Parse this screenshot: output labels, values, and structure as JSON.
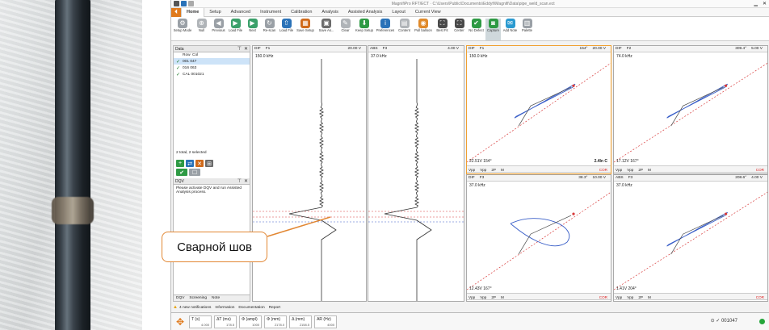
{
  "window": {
    "title": "MagnifiPro RFT/ECT · C:\\Users\\Public\\Documents\\Eddyfi\\Magnifi\\Data\\pipe_weld_scan.ect"
  },
  "menu": {
    "home_glyph": "⏴",
    "tabs": [
      "Home",
      "Setup",
      "Advanced",
      "Instrument",
      "Calibration",
      "Analysis",
      "Assisted Analysis",
      "Layout",
      "Current View"
    ]
  },
  "ribbon": {
    "buttons": [
      {
        "label": "Setup Mode",
        "icon": "gear-icon",
        "color": "#9aa0a6",
        "glyph": "⚙"
      },
      {
        "label": "Null",
        "icon": "target-icon",
        "color": "#b0b4b8",
        "glyph": "⊕"
      },
      {
        "label": "Previous",
        "icon": "previous-icon",
        "color": "#9aa0a6",
        "glyph": "◀"
      },
      {
        "label": "Load File",
        "icon": "load-file-icon",
        "color": "#3aa06a",
        "glyph": "▶"
      },
      {
        "label": "Next",
        "icon": "next-icon",
        "color": "#3aa06a",
        "glyph": "▶"
      },
      {
        "label": "Re-scan",
        "icon": "rescan-icon",
        "color": "#9aa0a6",
        "glyph": "↻"
      },
      {
        "label": "Load File",
        "icon": "upload-icon",
        "color": "#2a72b8",
        "glyph": "⇧"
      },
      {
        "label": "Save Setup",
        "icon": "save-setup-icon",
        "color": "#d06a1a",
        "glyph": "▦"
      },
      {
        "label": "Save As...",
        "icon": "save-as-icon",
        "color": "#6b6b6b",
        "glyph": "▣"
      },
      {
        "label": "Clear",
        "icon": "eraser-icon",
        "color": "#b0b4b8",
        "glyph": "✎"
      },
      {
        "label": "Keep Setup",
        "icon": "pin-icon",
        "color": "#2e9a44",
        "glyph": "⬇"
      },
      {
        "label": "Preferences",
        "icon": "info-icon",
        "color": "#2a72b8",
        "glyph": "i"
      },
      {
        "label": "Content",
        "icon": "content-icon",
        "color": "#b0b4b8",
        "glyph": "▤"
      },
      {
        "label": "Pull balloon",
        "icon": "balloon-icon",
        "color": "#e08a2a",
        "glyph": "◉"
      },
      {
        "label": "Best Fit",
        "icon": "best-fit-icon",
        "color": "#4a4a4a",
        "glyph": "⛶"
      },
      {
        "label": "Center",
        "icon": "center-icon",
        "color": "#4a4a4a",
        "glyph": "⛶"
      },
      {
        "label": "No Defect",
        "icon": "checkmark-icon",
        "color": "#2e9a44",
        "glyph": "✔"
      },
      {
        "label": "Capture",
        "icon": "camera-icon",
        "color": "#2e9a44",
        "glyph": "◙"
      },
      {
        "label": "Add Note",
        "icon": "note-icon",
        "color": "#2a9ad0",
        "glyph": "✉"
      },
      {
        "label": "Palette",
        "icon": "palette-icon",
        "color": "#9aa0a6",
        "glyph": "▥"
      }
    ]
  },
  "data_panel": {
    "title": "Data",
    "columns": [
      "Row",
      "Col"
    ],
    "rows": [
      {
        "text": "001  047",
        "selected": true,
        "check": "✓"
      },
      {
        "text": "016  063",
        "selected": false,
        "check": "✓"
      },
      {
        "text": "CAL 001021",
        "selected": false,
        "check": "✓"
      }
    ],
    "summary": "2 total, 2 selected"
  },
  "dqv_panel": {
    "title": "DQV",
    "message": "Please activate DQV and run Assisted Analysis process."
  },
  "bottom_tabs": [
    "DQV",
    "Screening",
    "Note"
  ],
  "status": {
    "notifications": "4 new notifications",
    "links": [
      "Information",
      "Documentation",
      "Report"
    ]
  },
  "measurements": [
    {
      "label": "T (s)",
      "value": "4.000"
    },
    {
      "label": "ΔT (ms)",
      "value": "178.5"
    },
    {
      "label": "Φ (ampl)",
      "value": "1000"
    },
    {
      "label": "Φ (mm)",
      "value": "2178.0"
    },
    {
      "label": "Δ (mm)",
      "value": "2158.5"
    },
    {
      "label": "AR (Hz)",
      "value": "4000"
    }
  ],
  "position": "001047",
  "strips": [
    {
      "tag": "DIF",
      "chan": "F1",
      "gain": "20.00 V",
      "freq": "150.0 kHz"
    },
    {
      "tag": "ABS",
      "chan": "F3",
      "gain": "4.00 V",
      "freq": "37.0 kHz"
    }
  ],
  "lissajous": [
    {
      "tag": "DIF",
      "chan": "F1",
      "rot": "154°",
      "gain": "20.00 V",
      "freq": "150.0 kHz",
      "reading": "22.51V 154°",
      "extra": "2.4In C",
      "highlight": true
    },
    {
      "tag": "DIF",
      "chan": "F2",
      "rot": "309.4°",
      "gain": "5.00 V",
      "freq": "74.0 kHz",
      "reading": "17.12V 167°",
      "extra": "",
      "highlight": false
    },
    {
      "tag": "DIF",
      "chan": "F3",
      "rot": "38.3°",
      "gain": "10.00 V",
      "freq": "37.0 kHz",
      "reading": "12.43V 167°",
      "extra": "",
      "highlight": false
    },
    {
      "tag": "ABS",
      "chan": "F3",
      "rot": "208.6°",
      "gain": "4.00 V",
      "freq": "37.0 kHz",
      "reading": "1.41V 204°",
      "extra": "",
      "highlight": false
    }
  ],
  "cbar_labels": [
    "Vpp",
    "Vpp",
    "2P",
    "M"
  ],
  "cor_label": "COR",
  "callout": "Сварной шов",
  "colors": {
    "accent": "#e28733",
    "signal_blue": "#3a5fc8",
    "ref_red": "#d83a3a",
    "check_green": "#1e7a2a"
  }
}
